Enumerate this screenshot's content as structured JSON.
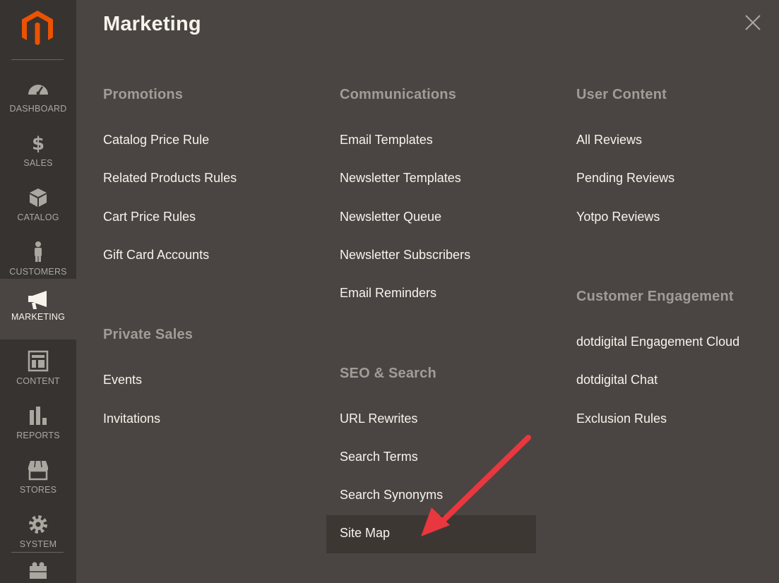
{
  "sidebar": {
    "items": [
      {
        "label": "DASHBOARD",
        "icon": "dashboard-icon"
      },
      {
        "label": "SALES",
        "icon": "dollar-icon"
      },
      {
        "label": "CATALOG",
        "icon": "box-icon"
      },
      {
        "label": "CUSTOMERS",
        "icon": "person-icon"
      },
      {
        "label": "MARKETING",
        "icon": "megaphone-icon",
        "active": true
      },
      {
        "label": "CONTENT",
        "icon": "layout-icon"
      },
      {
        "label": "REPORTS",
        "icon": "bar-chart-icon"
      },
      {
        "label": "STORES",
        "icon": "storefront-icon"
      },
      {
        "label": "SYSTEM",
        "icon": "gear-icon"
      }
    ]
  },
  "panel": {
    "title": "Marketing",
    "columns": [
      {
        "groups": [
          {
            "title": "Promotions",
            "items": [
              "Catalog Price Rule",
              "Related Products Rules",
              "Cart Price Rules",
              "Gift Card Accounts"
            ]
          },
          {
            "title": "Private Sales",
            "items": [
              "Events",
              "Invitations"
            ]
          }
        ]
      },
      {
        "groups": [
          {
            "title": "Communications",
            "items": [
              "Email Templates",
              "Newsletter Templates",
              "Newsletter Queue",
              "Newsletter Subscribers",
              "Email Reminders"
            ]
          },
          {
            "title": "SEO & Search",
            "items": [
              "URL Rewrites",
              "Search Terms",
              "Search Synonyms",
              "Site Map"
            ]
          }
        ]
      },
      {
        "groups": [
          {
            "title": "User Content",
            "items": [
              "All Reviews",
              "Pending Reviews",
              "Yotpo Reviews"
            ]
          },
          {
            "title": "Customer Engagement",
            "items": [
              "dotdigital Engagement Cloud",
              "dotdigital Chat",
              "Exclusion Rules"
            ]
          }
        ]
      }
    ]
  },
  "colors": {
    "sidebar_bg": "#373330",
    "panel_bg": "#4a4542",
    "brand_orange": "#eb5202",
    "arrow_red": "#e8373e",
    "highlight_bg": "#3d3734"
  }
}
